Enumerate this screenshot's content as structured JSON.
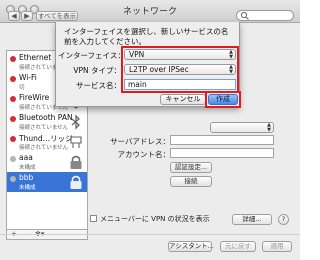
{
  "window": {
    "title": "ネットワーク",
    "show_all": "すべてを表示",
    "back": "◀",
    "forward": "▶"
  },
  "sidebar": {
    "items": [
      {
        "name": "Ethernet",
        "status": "接続されていません",
        "dot": "#d0302f",
        "icon": "ethernet-icon"
      },
      {
        "name": "Wi-Fi",
        "status": "切",
        "dot": "#d0302f",
        "icon": "wifi-icon"
      },
      {
        "name": "FireWire",
        "status": "接続されていません",
        "dot": "#d0302f",
        "icon": "firewire-icon"
      },
      {
        "name": "Bluetooth PAN",
        "status": "接続されていません",
        "dot": "#d0302f",
        "icon": "bluetooth-icon"
      },
      {
        "name": "Thund…リッジ",
        "status": "接続されていません",
        "dot": "#d0302f",
        "icon": "thunderbolt-icon"
      },
      {
        "name": "aaa",
        "status": "未構成",
        "dot": "#b5b5b5",
        "icon": "vpn-lock-icon"
      },
      {
        "name": "bbb",
        "status": "未構成",
        "dot": "#b5b5b5",
        "icon": "vpn-lock-icon",
        "selected": true
      }
    ],
    "add_label": "+",
    "remove_label": "–",
    "gear_label": "✻▾"
  },
  "detail": {
    "server_label": "サーバアドレス：",
    "account_label": "アカウント名：",
    "auth_button": "認証設定...",
    "connect_button": "接続",
    "menubar_label": "メニューバーに VPN の状況を表示",
    "advanced_button": "詳細...",
    "help_label": "?",
    "assistant_button": "アシスタント...",
    "revert_button": "元に戻す",
    "apply_button": "適用"
  },
  "sheet": {
    "message": "インターフェイスを選択し、新しいサービスの名前を入力してください。",
    "interface_label": "インターフェイス：",
    "interface_value": "VPN",
    "vpn_type_label": "VPN タイプ：",
    "vpn_type_value": "L2TP over IPSec",
    "service_name_label": "サービス名：",
    "service_name_value": "main",
    "cancel_button": "キャンセル",
    "create_button": "作成"
  },
  "colors": {
    "highlight_red": "#e11b22",
    "selection_blue": "#3875d7",
    "default_button_blue": "#4a88e4"
  }
}
